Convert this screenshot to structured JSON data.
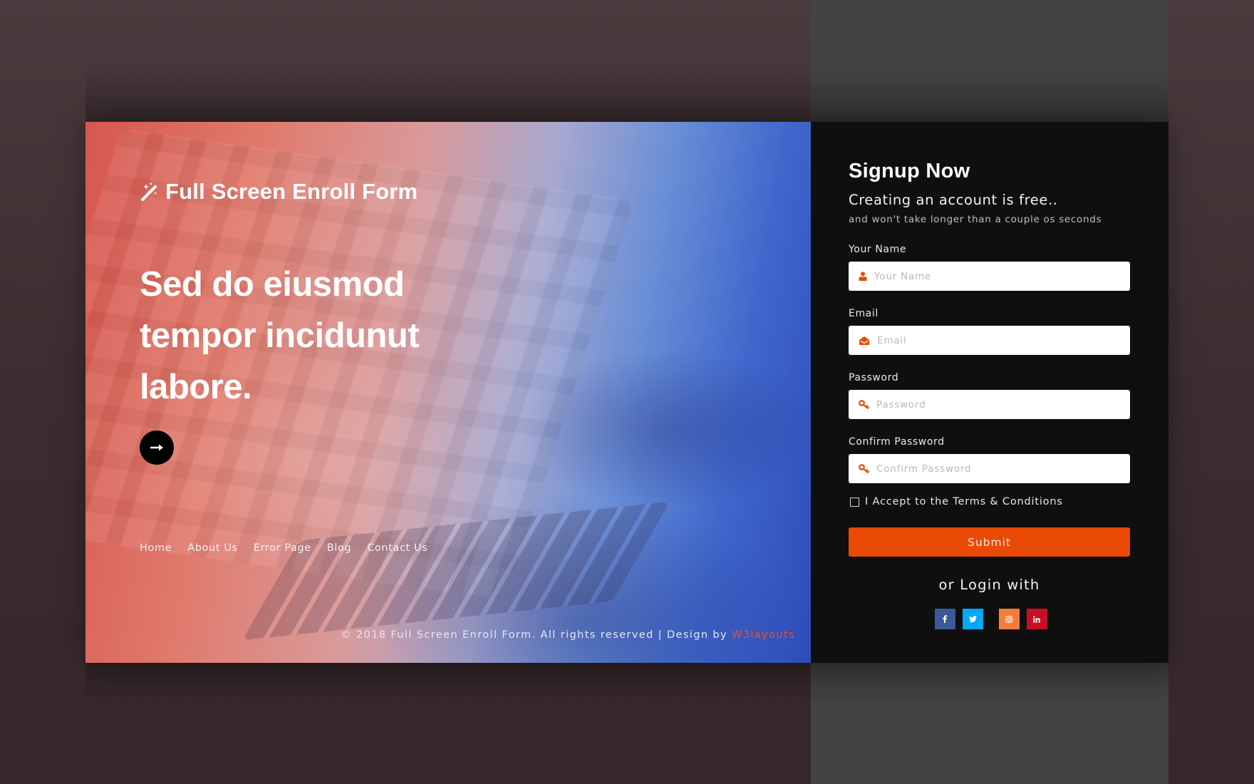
{
  "brand": {
    "title": "Full Screen Enroll Form",
    "icon": "magic-wand-icon"
  },
  "hero": {
    "headline": "Sed do eiusmod tempor incidunut labore.",
    "arrow_icon": "arrow-right-icon"
  },
  "nav": {
    "items": [
      {
        "label": "Home"
      },
      {
        "label": "About Us"
      },
      {
        "label": "Error Page"
      },
      {
        "label": "Blog"
      },
      {
        "label": "Contact Us"
      }
    ]
  },
  "footer": {
    "text": "© 2018 Full Screen Enroll Form. All rights reserved | Design by ",
    "link_label": "W3layouts",
    "link_color": "#e8512d"
  },
  "form": {
    "title": "Signup Now",
    "subtitle": "Creating an account is free..",
    "note": "and won't take longer than a couple os seconds",
    "fields": [
      {
        "label": "Your Name",
        "placeholder": "Your Name",
        "value": "",
        "icon": "user-icon",
        "type": "text"
      },
      {
        "label": "Email",
        "placeholder": "Email",
        "value": "",
        "icon": "envelope-open-icon",
        "type": "email"
      },
      {
        "label": "Password",
        "placeholder": "Password",
        "value": "",
        "icon": "key-icon",
        "type": "password"
      },
      {
        "label": "Confirm Password",
        "placeholder": "Confirm Password",
        "value": "",
        "icon": "key-icon",
        "type": "password"
      }
    ],
    "terms_label": "I Accept to the Terms & Conditions",
    "terms_checked": false,
    "submit_label": "Submit",
    "accent_color": "#e84a05",
    "or_login": "or Login with",
    "socials": [
      {
        "name": "facebook",
        "glyph": "f",
        "color": "#3b5998"
      },
      {
        "name": "twitter",
        "glyph": "t",
        "color": "#03a9f4"
      },
      {
        "name": "instagram",
        "glyph": "ig",
        "color": "#f57d38"
      },
      {
        "name": "linkedin",
        "glyph": "in",
        "color": "#c70e23"
      }
    ]
  }
}
